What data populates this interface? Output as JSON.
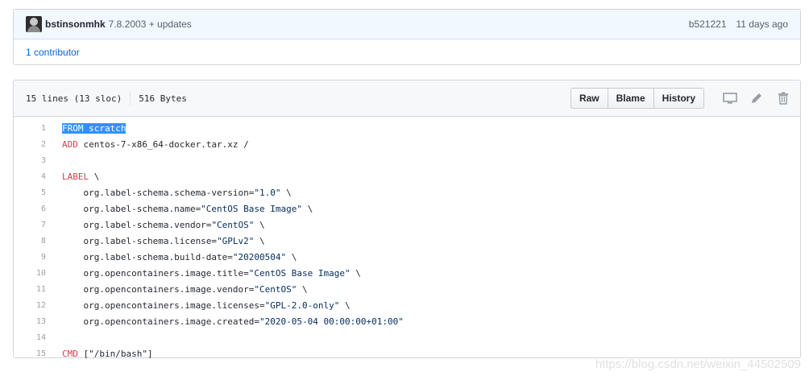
{
  "commit": {
    "author": "bstinsonmhk",
    "message": "7.8.2003 + updates",
    "sha": "b521221",
    "age": "11 days ago",
    "contributors_link": "1 contributor"
  },
  "file": {
    "lines_info": "15 lines (13 sloc)",
    "size": "516 Bytes",
    "buttons": {
      "raw": "Raw",
      "blame": "Blame",
      "history": "History"
    },
    "icons": [
      "desktop-icon",
      "pencil-icon",
      "trash-icon"
    ]
  },
  "code_lines": [
    {
      "num": "1",
      "kw": "FROM scratch",
      "rest": "",
      "selected": true
    },
    {
      "num": "2",
      "kw": "ADD",
      "rest": " centos-7-x86_64-docker.tar.xz /"
    },
    {
      "num": "3",
      "kw": "",
      "rest": ""
    },
    {
      "num": "4",
      "kw": "LABEL",
      "rest": " \\"
    },
    {
      "num": "5",
      "kw": "",
      "rest": "    org.label-schema.schema-version=",
      "str": "\"1.0\"",
      "tail": " \\"
    },
    {
      "num": "6",
      "kw": "",
      "rest": "    org.label-schema.name=",
      "str": "\"CentOS Base Image\"",
      "tail": " \\"
    },
    {
      "num": "7",
      "kw": "",
      "rest": "    org.label-schema.vendor=",
      "str": "\"CentOS\"",
      "tail": " \\"
    },
    {
      "num": "8",
      "kw": "",
      "rest": "    org.label-schema.license=",
      "str": "\"GPLv2\"",
      "tail": " \\"
    },
    {
      "num": "9",
      "kw": "",
      "rest": "    org.label-schema.build-date=",
      "str": "\"20200504\"",
      "tail": " \\"
    },
    {
      "num": "10",
      "kw": "",
      "rest": "    org.opencontainers.image.title=",
      "str": "\"CentOS Base Image\"",
      "tail": " \\"
    },
    {
      "num": "11",
      "kw": "",
      "rest": "    org.opencontainers.image.vendor=",
      "str": "\"CentOS\"",
      "tail": " \\"
    },
    {
      "num": "12",
      "kw": "",
      "rest": "    org.opencontainers.image.licenses=",
      "str": "\"GPL-2.0-only\"",
      "tail": " \\"
    },
    {
      "num": "13",
      "kw": "",
      "rest": "    org.opencontainers.image.created=",
      "str": "\"2020-05-04 00:00:00+01:00\"",
      "tail": ""
    },
    {
      "num": "14",
      "kw": "",
      "rest": ""
    },
    {
      "num": "15",
      "kw": "CMD",
      "rest": " [\"/bin/bash\"]"
    }
  ],
  "watermark": "https://blog.csdn.net/weixin_44502509",
  "colors": {
    "keyword": "#d73a49",
    "string": "#032f62",
    "selection": "#3390ff",
    "link": "#0366d6"
  }
}
